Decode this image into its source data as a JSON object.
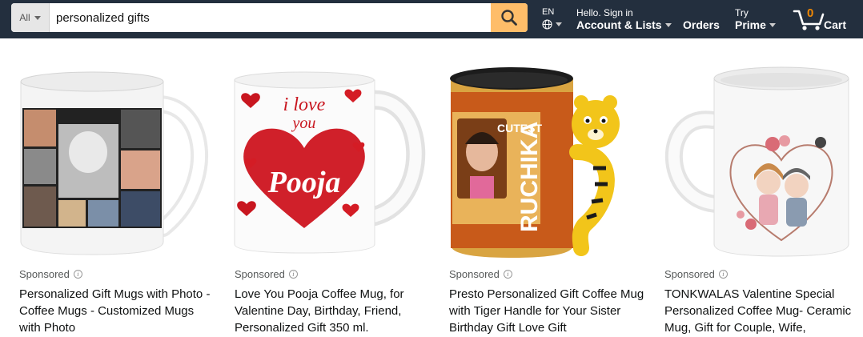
{
  "search": {
    "category": "All",
    "query": "personalized gifts"
  },
  "nav": {
    "language_code": "EN",
    "account_line1": "Hello. Sign in",
    "account_line2": "Account & Lists",
    "orders": "Orders",
    "prime_line1": "Try",
    "prime_line2": "Prime",
    "cart_count": "0",
    "cart_label": "Cart"
  },
  "products": [
    {
      "sponsored": "Sponsored",
      "title": "Personalized Gift Mugs with Photo - Coffee Mugs - Customized Mugs with Photo"
    },
    {
      "sponsored": "Sponsored",
      "title": "Love You Pooja Coffee Mug, for Valentine Day, Birthday, Friend, Personalized Gift 350 ml."
    },
    {
      "sponsored": "Sponsored",
      "title": "Presto Personalized Gift Coffee Mug with Tiger Handle for Your Sister Birthday Gift Love Gift"
    },
    {
      "sponsored": "Sponsored",
      "title": "TONKWALAS Valentine Special Personalized Coffee Mug- Ceramic Mug, Gift for Couple, Wife,"
    }
  ],
  "images": {
    "mug2_love": "i love",
    "mug2_you": "you",
    "mug2_name": "Pooja",
    "mug3_cutest": "CUTEST",
    "mug3_name": "RUCHIKA"
  },
  "colors": {
    "header_bg": "#232f3e",
    "search_button": "#febd69",
    "cart_count": "#f08804",
    "heart_red": "#d0202a"
  },
  "icons": {
    "search": "search-icon",
    "globe": "globe-icon",
    "cart": "cart-icon",
    "info": "info-icon"
  }
}
